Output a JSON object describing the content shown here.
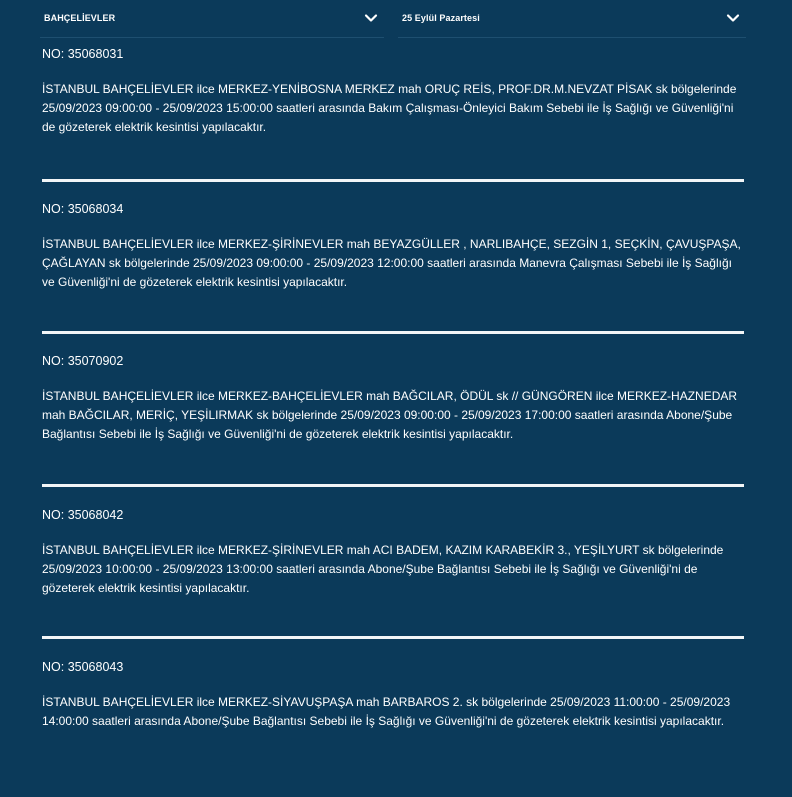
{
  "filters": {
    "district": {
      "value": "BAHÇELİEVLER",
      "icon": "chevron-down-icon"
    },
    "date": {
      "value": "25 Eylül Pazartesi",
      "icon": "chevron-down-icon"
    }
  },
  "notices": [
    {
      "no": "NO: 35068031",
      "text": "İSTANBUL BAHÇELİEVLER ilce MERKEZ-YENİBOSNA MERKEZ mah ORUÇ REİS, PROF.DR.M.NEVZAT PİSAK sk bölgelerinde 25/09/2023 09:00:00 - 25/09/2023 15:00:00 saatleri arasında Bakım Çalışması-Önleyici Bakım Sebebi ile İş Sağlığı ve Güvenliği'ni de gözeterek elektrik kesintisi yapılacaktır."
    },
    {
      "no": "NO: 35068034",
      "text": "İSTANBUL BAHÇELİEVLER ilce MERKEZ-ŞİRİNEVLER mah BEYAZGÜLLER , NARLIBAHÇE, SEZGİN 1, SEÇKİN, ÇAVUŞPAŞA, ÇAĞLAYAN sk bölgelerinde 25/09/2023 09:00:00 - 25/09/2023 12:00:00 saatleri arasında Manevra Çalışması Sebebi ile İş Sağlığı ve Güvenliği'ni de gözeterek elektrik kesintisi yapılacaktır."
    },
    {
      "no": "NO: 35070902",
      "text": "İSTANBUL BAHÇELİEVLER ilce MERKEZ-BAHÇELİEVLER mah BAĞCILAR, ÖDÜL sk // GÜNGÖREN ilce MERKEZ-HAZNEDAR mah BAĞCILAR, MERİÇ, YEŞİLIRMAK sk bölgelerinde 25/09/2023 09:00:00 - 25/09/2023 17:00:00 saatleri arasında Abone/Şube Bağlantısı Sebebi ile İş Sağlığı ve Güvenliği'ni de gözeterek elektrik kesintisi yapılacaktır."
    },
    {
      "no": "NO: 35068042",
      "text": "İSTANBUL BAHÇELİEVLER ilce MERKEZ-ŞİRİNEVLER mah ACI BADEM, KAZIM KARABEKİR 3., YEŞİLYURT sk bölgelerinde 25/09/2023 10:00:00 - 25/09/2023 13:00:00 saatleri arasında Abone/Şube Bağlantısı Sebebi ile İş Sağlığı ve Güvenliği'ni de gözeterek elektrik kesintisi yapılacaktır."
    },
    {
      "no": "NO: 35068043",
      "text": "İSTANBUL BAHÇELİEVLER ilce MERKEZ-SİYAVUŞPAŞA mah BARBAROS 2. sk bölgelerinde 25/09/2023 11:00:00 - 25/09/2023 14:00:00 saatleri arasında Abone/Şube Bağlantısı Sebebi ile İş Sağlığı ve Güvenliği'ni de gözeterek elektrik kesintisi yapılacaktır."
    }
  ]
}
